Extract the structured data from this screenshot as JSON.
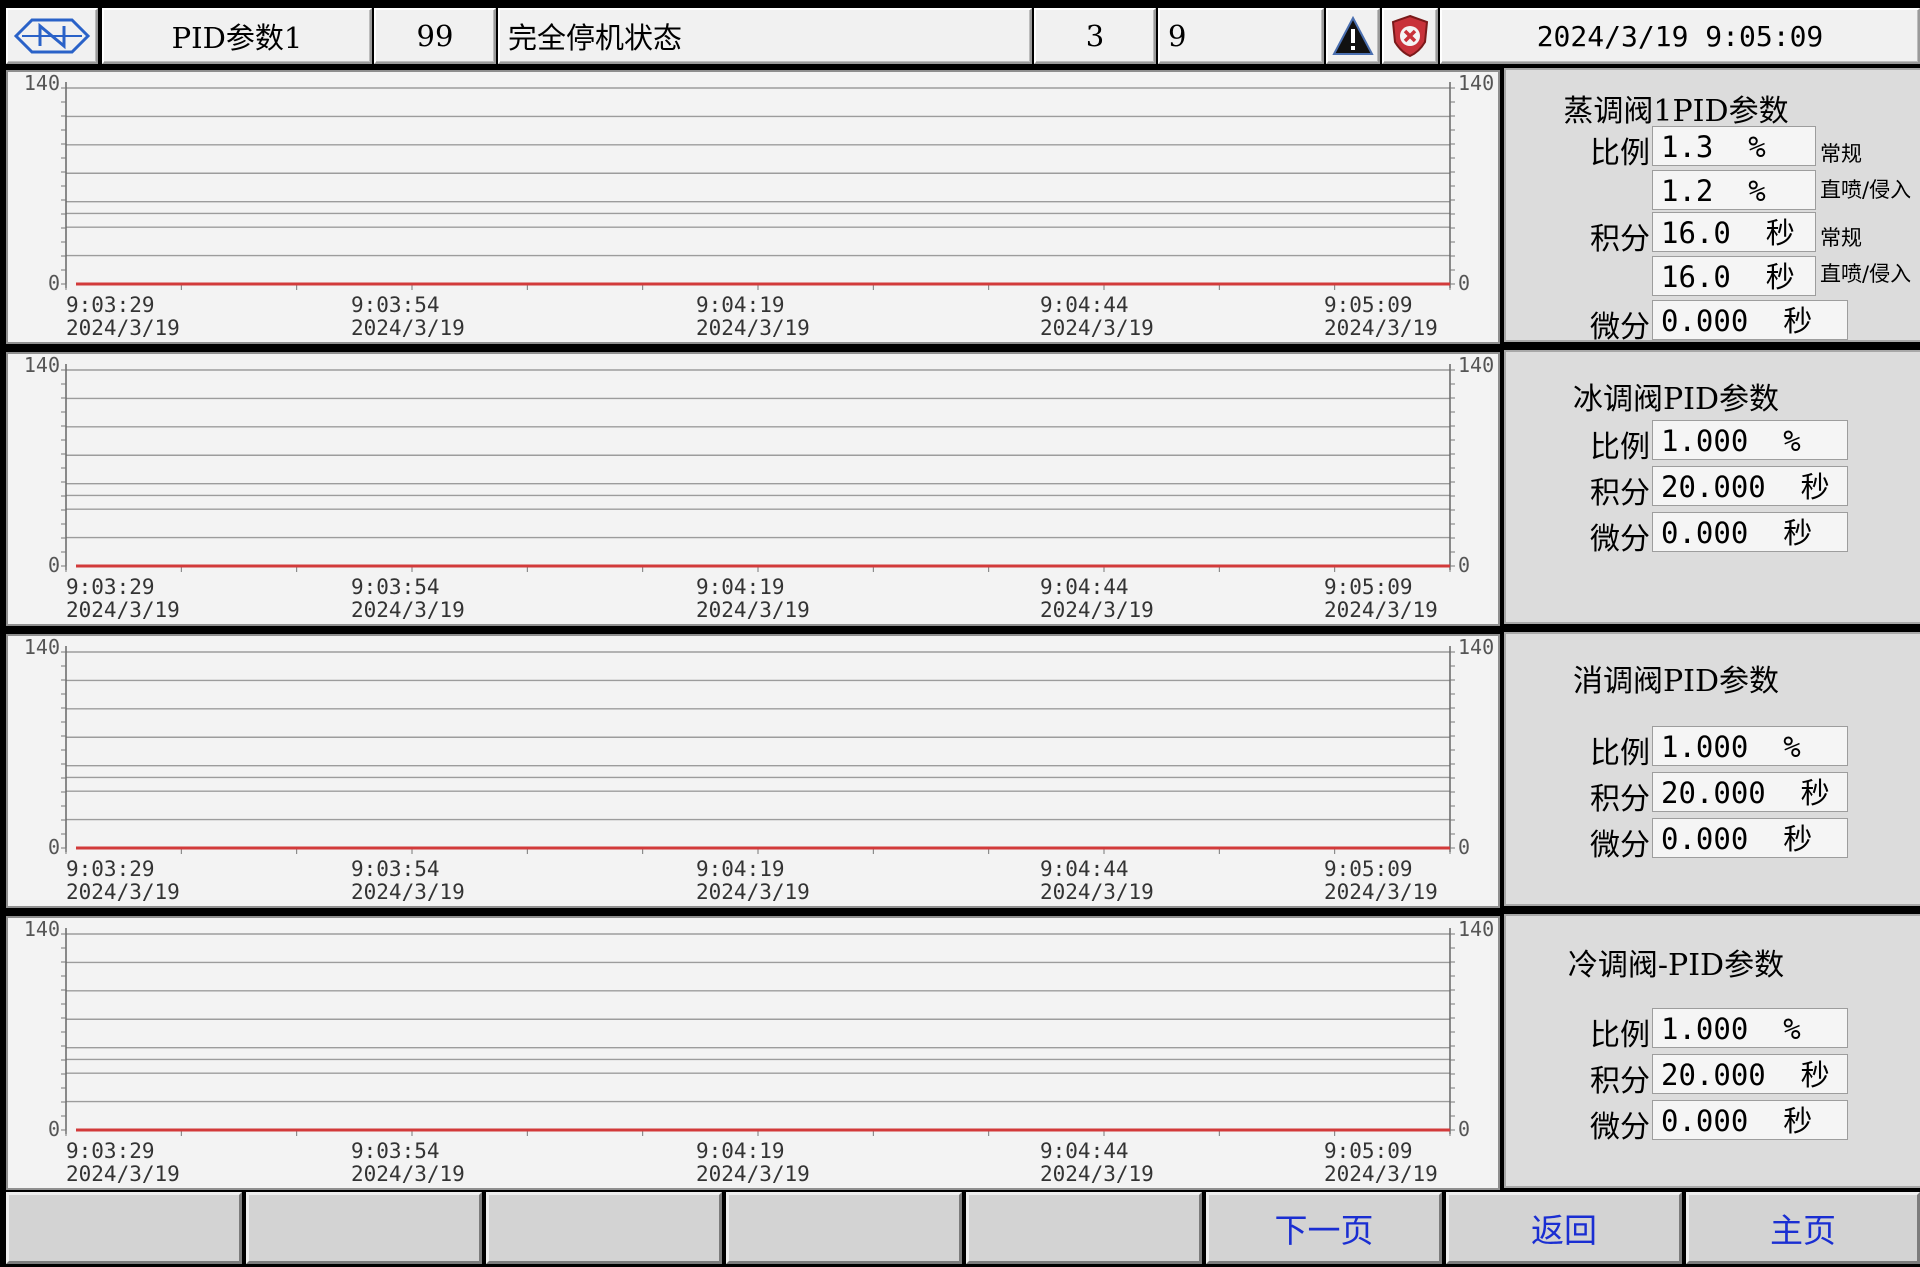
{
  "header": {
    "page_name": "PID参数1",
    "code": "99",
    "status": "完全停机状态",
    "count_a": "3",
    "count_b": "9",
    "warning_icon": "warning-triangle-icon",
    "alarm_icon": "shield-error-icon",
    "datetime": "2024/3/19 9:05:09"
  },
  "charts": [
    {
      "y_top": "140",
      "y_bottom": "0",
      "y_top_r": "140",
      "y_bottom_r": "0"
    },
    {
      "y_top": "140",
      "y_bottom": "0",
      "y_top_r": "140",
      "y_bottom_r": "0"
    },
    {
      "y_top": "140",
      "y_bottom": "0",
      "y_top_r": "140",
      "y_bottom_r": "0"
    },
    {
      "y_top": "140",
      "y_bottom": "0",
      "y_top_r": "140",
      "y_bottom_r": "0"
    }
  ],
  "time_labels": [
    {
      "time": "9:03:29",
      "date": "2024/3/19"
    },
    {
      "time": "9:03:54",
      "date": "2024/3/19"
    },
    {
      "time": "9:04:19",
      "date": "2024/3/19"
    },
    {
      "time": "9:04:44",
      "date": "2024/3/19"
    },
    {
      "time": "9:05:09",
      "date": "2024/3/19"
    }
  ],
  "panels": {
    "p1": {
      "title": "蒸调阀1PID参数",
      "prop_label": "比例",
      "prop_normal": "1.3  %",
      "prop_normal_note": "常规",
      "prop_jet": "1.2  %",
      "prop_jet_note": "直喷/侵入",
      "int_label": "积分",
      "int_normal": "16.0  秒",
      "int_normal_note": "常规",
      "int_jet": "16.0  秒",
      "int_jet_note": "直喷/侵入",
      "der_label": "微分",
      "der": "0.000  秒"
    },
    "p2": {
      "title": "冰调阀PID参数",
      "prop_label": "比例",
      "prop": "1.000  %",
      "int_label": "积分",
      "int": "20.000  秒",
      "der_label": "微分",
      "der": "0.000  秒"
    },
    "p3": {
      "title": "消调阀PID参数",
      "prop_label": "比例",
      "prop": "1.000  %",
      "int_label": "积分",
      "int": "20.000  秒",
      "der_label": "微分",
      "der": "0.000  秒"
    },
    "p4": {
      "title": "冷调阀-PID参数",
      "prop_label": "比例",
      "prop": "1.000  %",
      "int_label": "积分",
      "int": "20.000  秒",
      "der_label": "微分",
      "der": "0.000  秒"
    }
  },
  "buttons": {
    "b1": "",
    "b2": "",
    "b3": "",
    "b4": "",
    "b5": "",
    "next": "下一页",
    "back": "返回",
    "home": "主页"
  },
  "chart_data": [
    {
      "type": "line",
      "title": "",
      "xlabel": "",
      "ylabel": "",
      "ylim": [
        0,
        140
      ],
      "x": [
        "9:03:29",
        "9:03:54",
        "9:04:19",
        "9:04:44",
        "9:05:09"
      ],
      "series": [
        {
          "values": [
            0,
            0,
            0,
            0,
            0
          ],
          "color": "#d23a3a"
        }
      ],
      "grid": true
    },
    {
      "type": "line",
      "title": "",
      "xlabel": "",
      "ylabel": "",
      "ylim": [
        0,
        140
      ],
      "x": [
        "9:03:29",
        "9:03:54",
        "9:04:19",
        "9:04:44",
        "9:05:09"
      ],
      "series": [
        {
          "values": [
            0,
            0,
            0,
            0,
            0
          ],
          "color": "#d23a3a"
        }
      ],
      "grid": true
    },
    {
      "type": "line",
      "title": "",
      "xlabel": "",
      "ylabel": "",
      "ylim": [
        0,
        140
      ],
      "x": [
        "9:03:29",
        "9:03:54",
        "9:04:19",
        "9:04:44",
        "9:05:09"
      ],
      "series": [
        {
          "values": [
            0,
            0,
            0,
            0,
            0
          ],
          "color": "#d23a3a"
        }
      ],
      "grid": true
    },
    {
      "type": "line",
      "title": "",
      "xlabel": "",
      "ylabel": "",
      "ylim": [
        0,
        140
      ],
      "x": [
        "9:03:29",
        "9:03:54",
        "9:04:19",
        "9:04:44",
        "9:05:09"
      ],
      "series": [
        {
          "values": [
            0,
            0,
            0,
            0,
            0
          ],
          "color": "#d23a3a"
        }
      ],
      "grid": true
    }
  ]
}
